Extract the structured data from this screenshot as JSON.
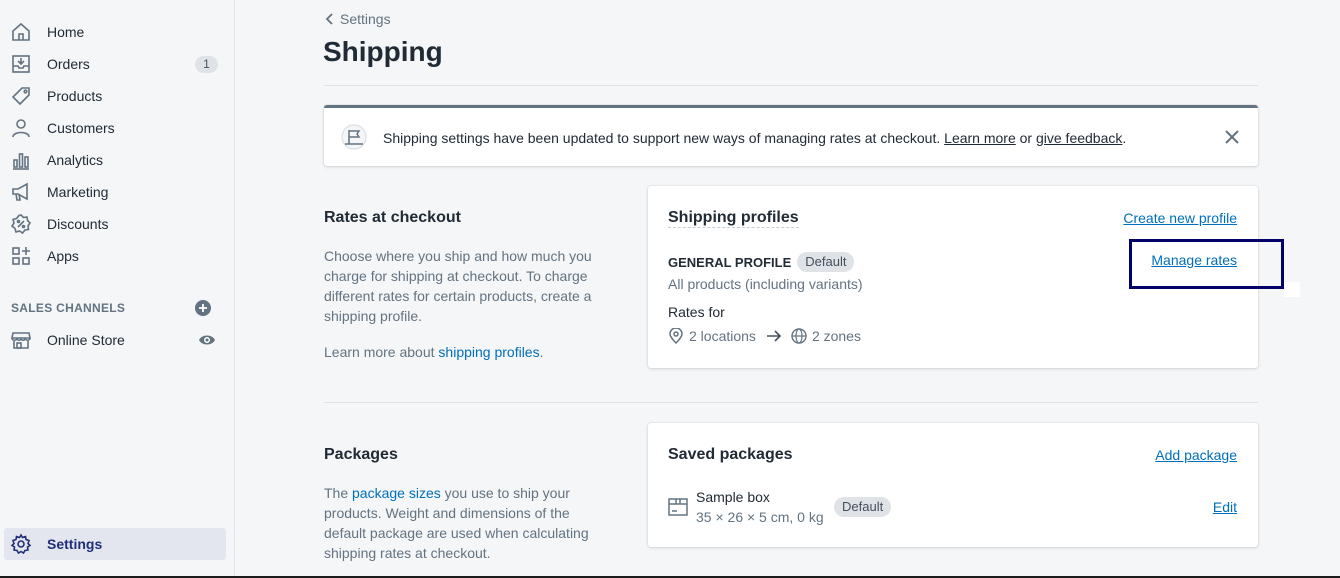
{
  "sidebar": {
    "items": [
      {
        "label": "Home",
        "icon": "home-icon"
      },
      {
        "label": "Orders",
        "icon": "orders-icon",
        "badge": "1"
      },
      {
        "label": "Products",
        "icon": "tag-icon"
      },
      {
        "label": "Customers",
        "icon": "person-icon"
      },
      {
        "label": "Analytics",
        "icon": "bar-chart-icon"
      },
      {
        "label": "Marketing",
        "icon": "megaphone-icon"
      },
      {
        "label": "Discounts",
        "icon": "discount-icon"
      },
      {
        "label": "Apps",
        "icon": "apps-icon"
      }
    ],
    "sales_channels_title": "SALES CHANNELS",
    "online_store_label": "Online Store",
    "settings_label": "Settings"
  },
  "header": {
    "breadcrumb": "Settings",
    "title": "Shipping"
  },
  "banner": {
    "text": "Shipping settings have been updated to support new ways of managing rates at checkout.",
    "learn_more": "Learn more",
    "or": "or",
    "give_feedback": "give feedback",
    "period": "."
  },
  "rates_section": {
    "title": "Rates at checkout",
    "description": "Choose where you ship and how much you charge for shipping at checkout. To charge different rates for certain products, create a shipping profile.",
    "learn_prefix": "Learn more about",
    "learn_link": "shipping profiles",
    "learn_suffix": "."
  },
  "profiles_card": {
    "title": "Shipping profiles",
    "create_action": "Create new profile",
    "profile_name": "GENERAL PROFILE",
    "profile_badge": "Default",
    "profile_desc": "All products (including variants)",
    "rates_for": "Rates for",
    "locations": "2 locations",
    "zones": "2 zones",
    "manage_rates": "Manage rates"
  },
  "packages_section": {
    "title": "Packages",
    "desc_prefix": "The",
    "desc_link": "package sizes",
    "desc_suffix": "you use to ship your products. Weight and dimensions of the default package are used when calculating shipping rates at checkout."
  },
  "packages_card": {
    "title": "Saved packages",
    "add_action": "Add package",
    "package_name": "Sample box",
    "package_dims": "35 × 26 × 5 cm, 0 kg",
    "package_badge": "Default",
    "edit": "Edit"
  },
  "colors": {
    "link": "#006fbb",
    "highlight": "#000066",
    "active_nav": "#202e78"
  }
}
